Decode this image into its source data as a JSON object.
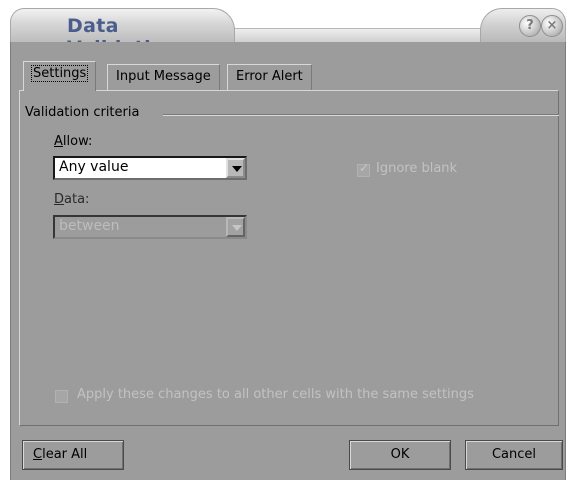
{
  "window": {
    "title": "Data Validation",
    "help_icon": "help-icon",
    "close_icon": "close-icon",
    "help_glyph": "?",
    "close_glyph": "×"
  },
  "tabs": [
    {
      "label": "Settings",
      "active": true
    },
    {
      "label": "Input Message",
      "active": false
    },
    {
      "label": "Error Alert",
      "active": false
    }
  ],
  "settings": {
    "group_label": "Validation criteria",
    "allow_label_access": "A",
    "allow_label_rest": "llow:",
    "allow_value": "Any value",
    "ignore_blank_label": "Ignore blank",
    "ignore_blank_checked": true,
    "data_label_access": "D",
    "data_label_rest": "ata:",
    "data_value": "between",
    "apply_label": "Apply these changes to all other cells with the same settings"
  },
  "buttons": {
    "clear_all_access": "C",
    "clear_all_rest": "lear All",
    "ok": "OK",
    "cancel": "Cancel"
  }
}
